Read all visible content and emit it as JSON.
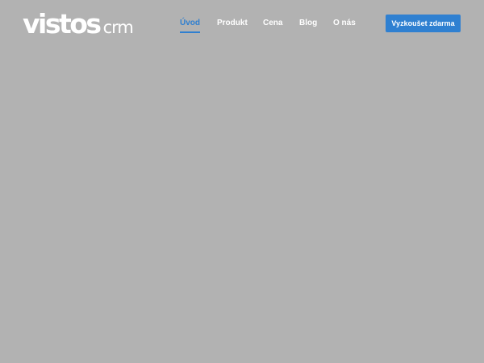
{
  "logo": {
    "main": "vistos",
    "sub": "crm"
  },
  "nav": {
    "items": [
      {
        "label": "Úvod",
        "active": true
      },
      {
        "label": "Produkt",
        "active": false
      },
      {
        "label": "Cena",
        "active": false
      },
      {
        "label": "Blog",
        "active": false
      },
      {
        "label": "O nás",
        "active": false
      }
    ]
  },
  "cta": {
    "label": "Vyzkoušet zdarma"
  },
  "colors": {
    "background": "#b2b2b2",
    "accent": "#2f80d1",
    "text": "#ffffff"
  }
}
